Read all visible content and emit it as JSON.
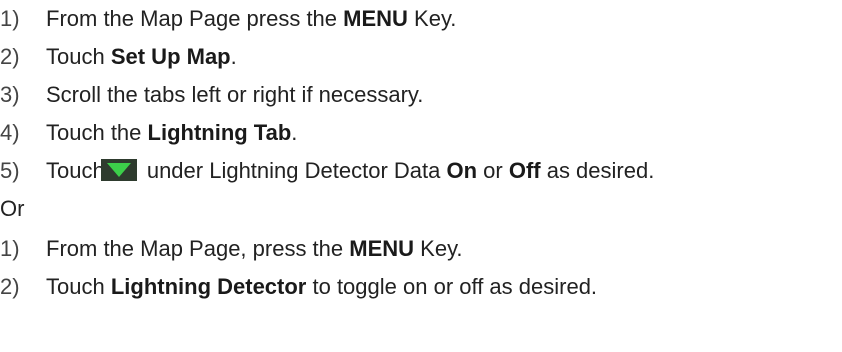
{
  "instructions_a": [
    {
      "num": "1)",
      "pre": "From the Map Page press the ",
      "bold": "MENU",
      "post": " Key."
    },
    {
      "num": "2)",
      "pre": "Touch ",
      "bold": "Set Up Map",
      "post": "."
    },
    {
      "num": "3)",
      "pre": "Scroll the tabs left or right if necessary.",
      "bold": "",
      "post": ""
    },
    {
      "num": "4)",
      "pre": "Touch the ",
      "bold": "Lightning Tab",
      "post": "."
    },
    {
      "num": "5)",
      "pre": "Touch",
      "icon": "green-down-triangle-icon",
      "mid": " under Lightning Detector Data ",
      "bold1": "On",
      "mid2": " or ",
      "bold2": "Off",
      "post": " as desired."
    }
  ],
  "or_label": "Or",
  "instructions_b": [
    {
      "num": "1)",
      "pre": "From the Map Page, press the ",
      "bold": "MENU",
      "post": " Key."
    },
    {
      "num": "2)",
      "pre": "Touch ",
      "bold": "Lightning Detector",
      "post": " to toggle on or off as desired."
    }
  ],
  "colors": {
    "icon_background": "#2e3b2e",
    "icon_triangle": "#3ccf4a"
  }
}
